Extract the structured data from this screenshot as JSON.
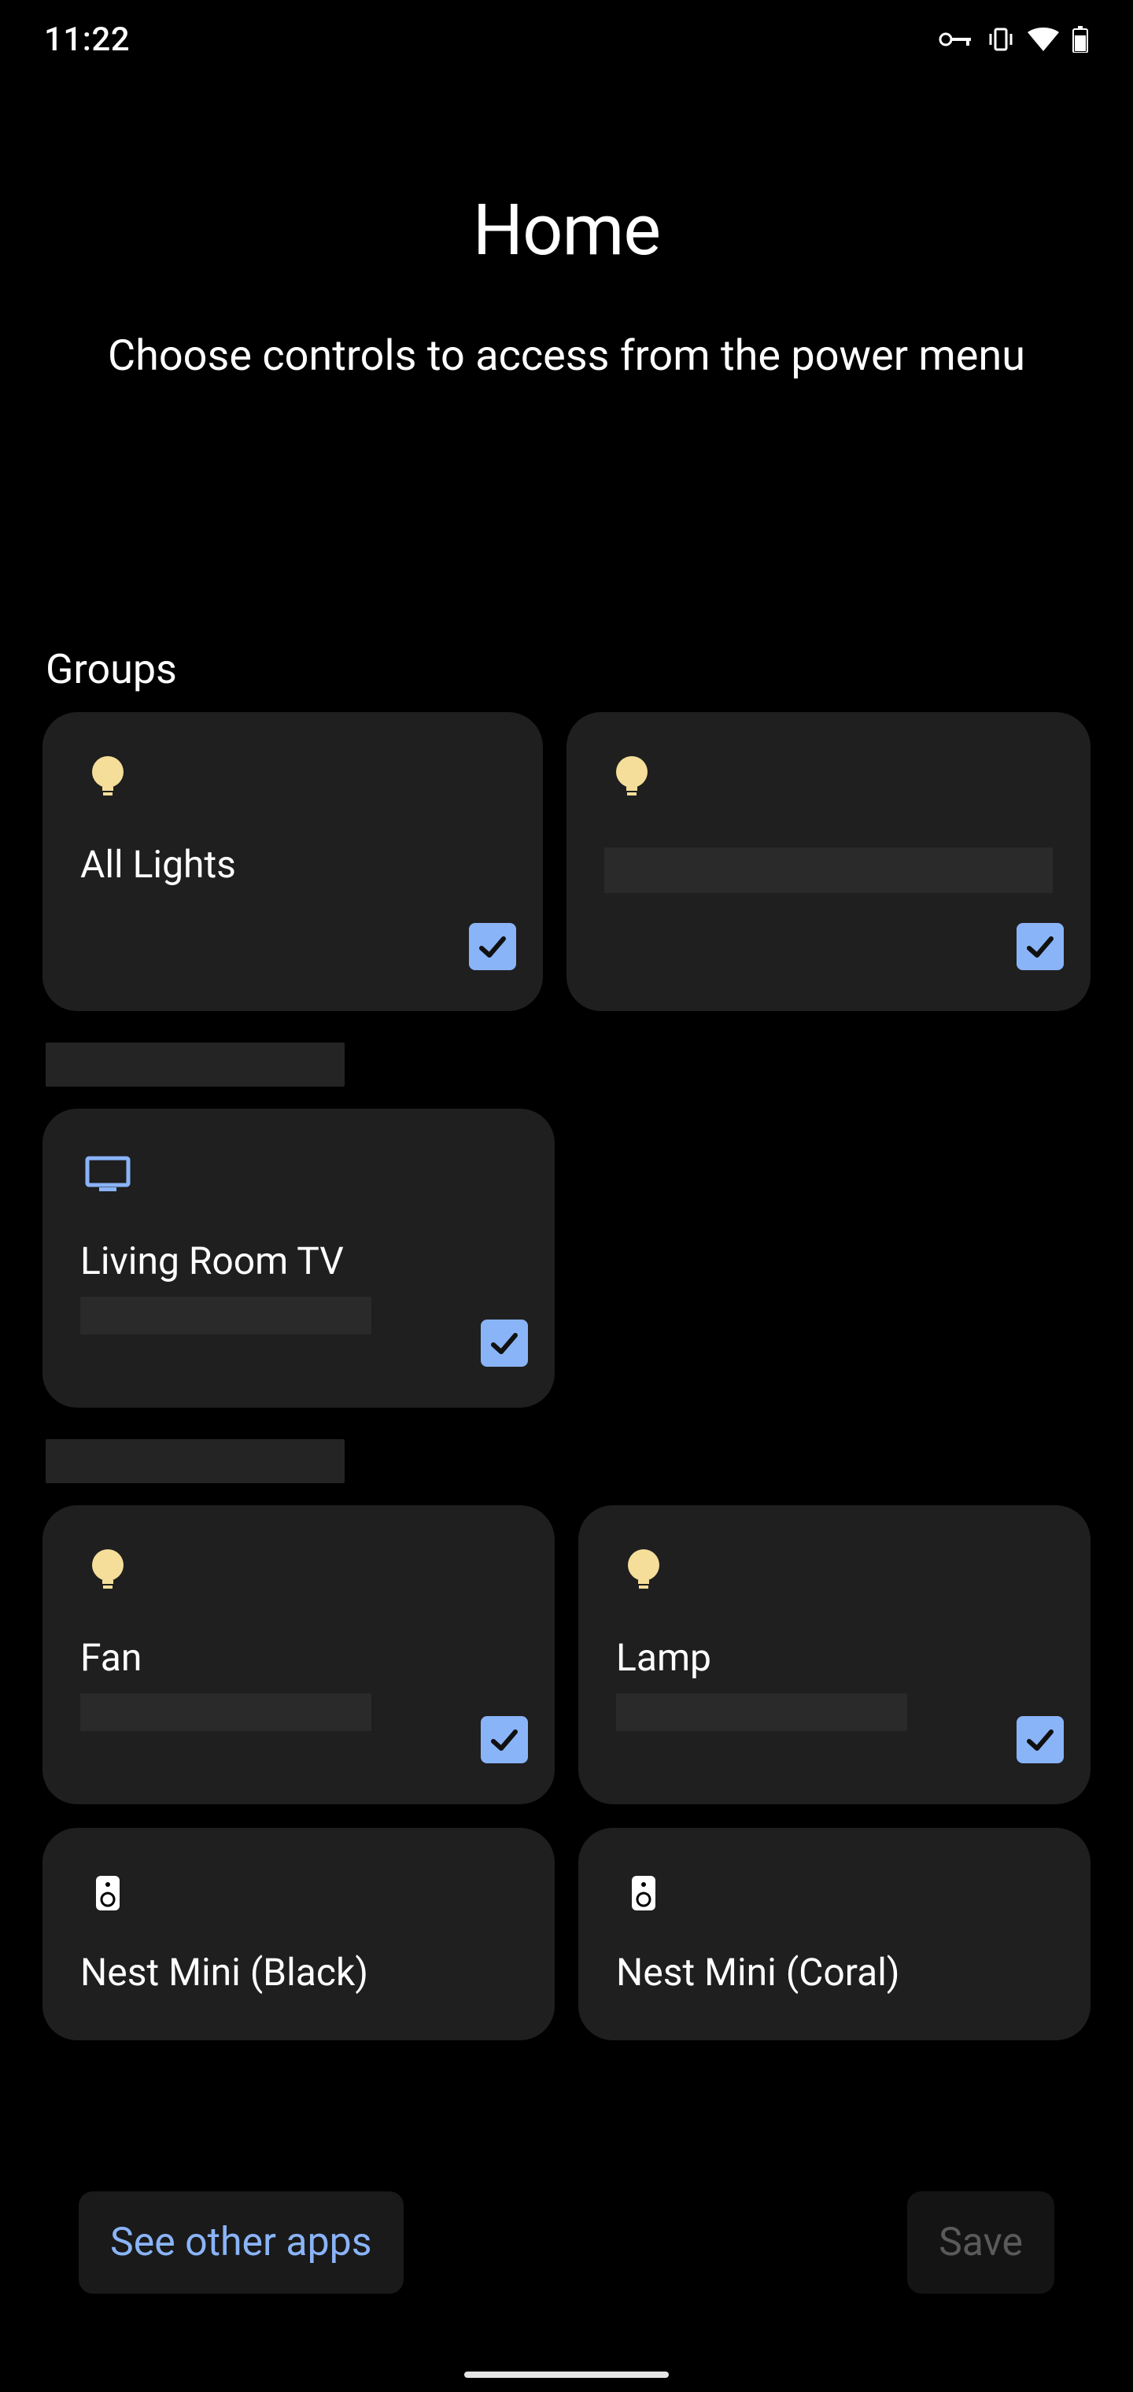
{
  "status": {
    "time": "11:22"
  },
  "header": {
    "title": "Home",
    "subtitle": "Choose controls to access from the power menu"
  },
  "sections": {
    "groups": {
      "title": "Groups",
      "cards": [
        {
          "name": "All Lights",
          "icon": "bulb",
          "checked": true,
          "name_redacted": false
        },
        {
          "name": "",
          "icon": "bulb",
          "checked": true,
          "name_redacted": true
        }
      ]
    },
    "room1": {
      "title_redacted": true,
      "cards": [
        {
          "name": "Living Room TV",
          "icon": "tv",
          "checked": true,
          "sub_redacted": true
        }
      ]
    },
    "room2": {
      "title_redacted": true,
      "cards": [
        {
          "name": "Fan",
          "icon": "bulb",
          "checked": true,
          "sub_redacted": true
        },
        {
          "name": "Lamp",
          "icon": "bulb",
          "checked": true,
          "sub_redacted": true
        },
        {
          "name": "Nest Mini (Black)",
          "icon": "speaker",
          "checked": true,
          "cutoff": true
        },
        {
          "name": "Nest Mini (Coral)",
          "icon": "speaker",
          "checked": true,
          "cutoff": true
        }
      ]
    }
  },
  "bottom": {
    "see_other": "See other apps",
    "save": "Save"
  },
  "colors": {
    "accent": "#8ab4f8",
    "bulb": "#f5de9a"
  }
}
